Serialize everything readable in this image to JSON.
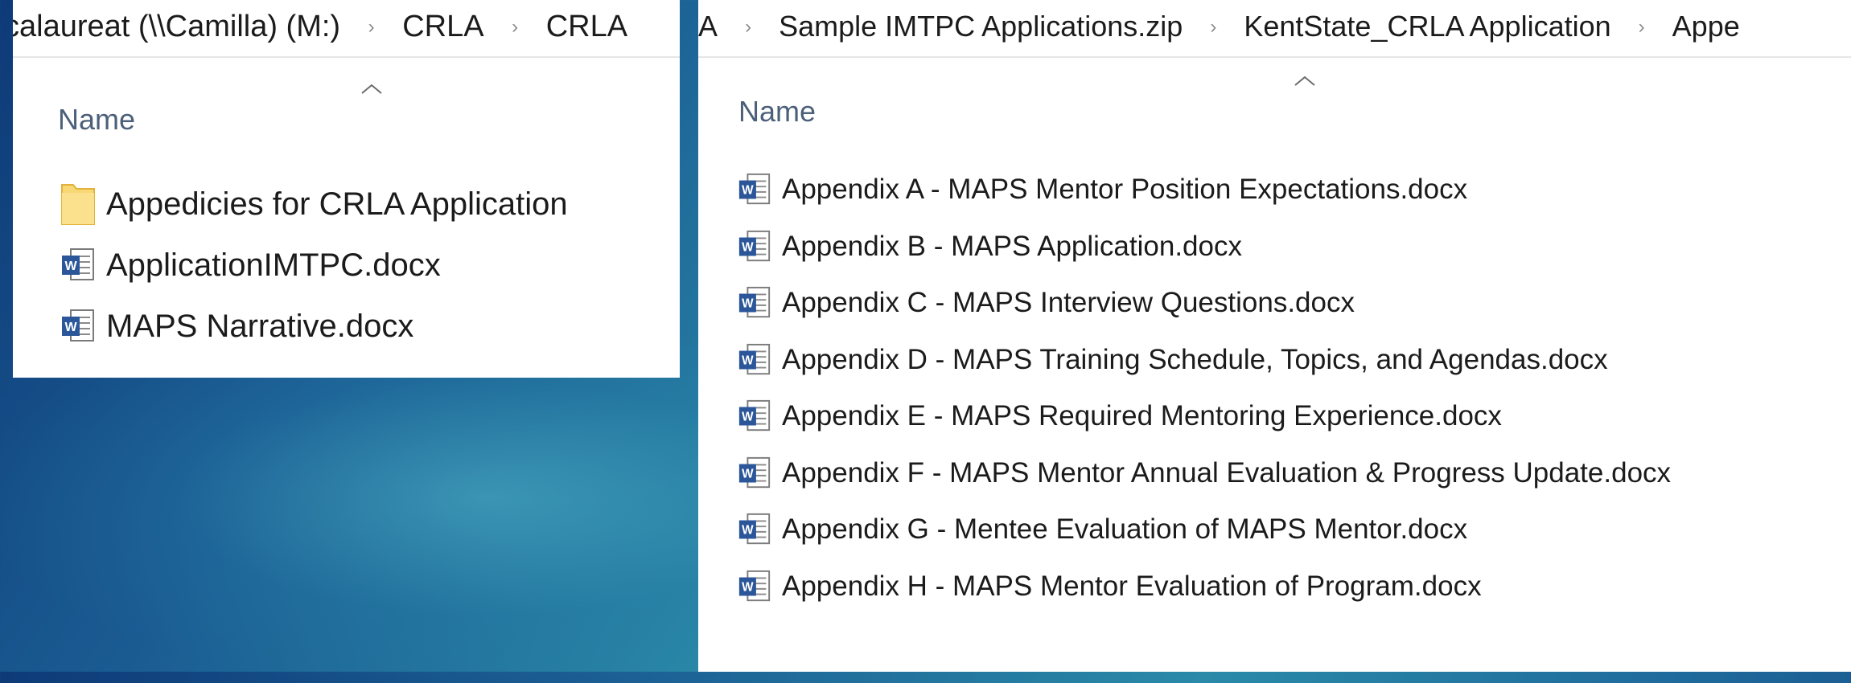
{
  "left_window": {
    "breadcrumb": [
      "ccalaureat (\\\\Camilla) (M:)",
      "CRLA",
      "CRLA"
    ],
    "column_header": "Name",
    "items": [
      {
        "type": "folder",
        "name": "Appedicies for CRLA Application",
        "icon": "folder-icon"
      },
      {
        "type": "docx",
        "name": "ApplicationIMTPC.docx",
        "icon": "word-doc-icon"
      },
      {
        "type": "docx",
        "name": "MAPS Narrative.docx",
        "icon": "word-doc-icon"
      }
    ]
  },
  "right_window": {
    "breadcrumb": [
      "LA",
      "Sample IMTPC Applications.zip",
      "KentState_CRLA Application",
      "Appe"
    ],
    "column_header": "Name",
    "items": [
      {
        "type": "docx",
        "name": "Appendix A - MAPS Mentor Position Expectations.docx",
        "icon": "word-doc-icon"
      },
      {
        "type": "docx",
        "name": "Appendix B - MAPS Application.docx",
        "icon": "word-doc-icon"
      },
      {
        "type": "docx",
        "name": "Appendix C - MAPS Interview Questions.docx",
        "icon": "word-doc-icon"
      },
      {
        "type": "docx",
        "name": "Appendix D - MAPS Training Schedule, Topics, and Agendas.docx",
        "icon": "word-doc-icon"
      },
      {
        "type": "docx",
        "name": "Appendix E - MAPS Required Mentoring Experience.docx",
        "icon": "word-doc-icon"
      },
      {
        "type": "docx",
        "name": "Appendix F - MAPS Mentor Annual Evaluation & Progress Update.docx",
        "icon": "word-doc-icon"
      },
      {
        "type": "docx",
        "name": "Appendix G - Mentee Evaluation of MAPS Mentor.docx",
        "icon": "word-doc-icon"
      },
      {
        "type": "docx",
        "name": "Appendix H - MAPS Mentor Evaluation of Program.docx",
        "icon": "word-doc-icon"
      }
    ]
  },
  "colors": {
    "background_dark": "#0e3a78",
    "background_teal": "#2a8aa8",
    "folder_yellow": "#f8d775",
    "word_blue": "#2b579a"
  }
}
